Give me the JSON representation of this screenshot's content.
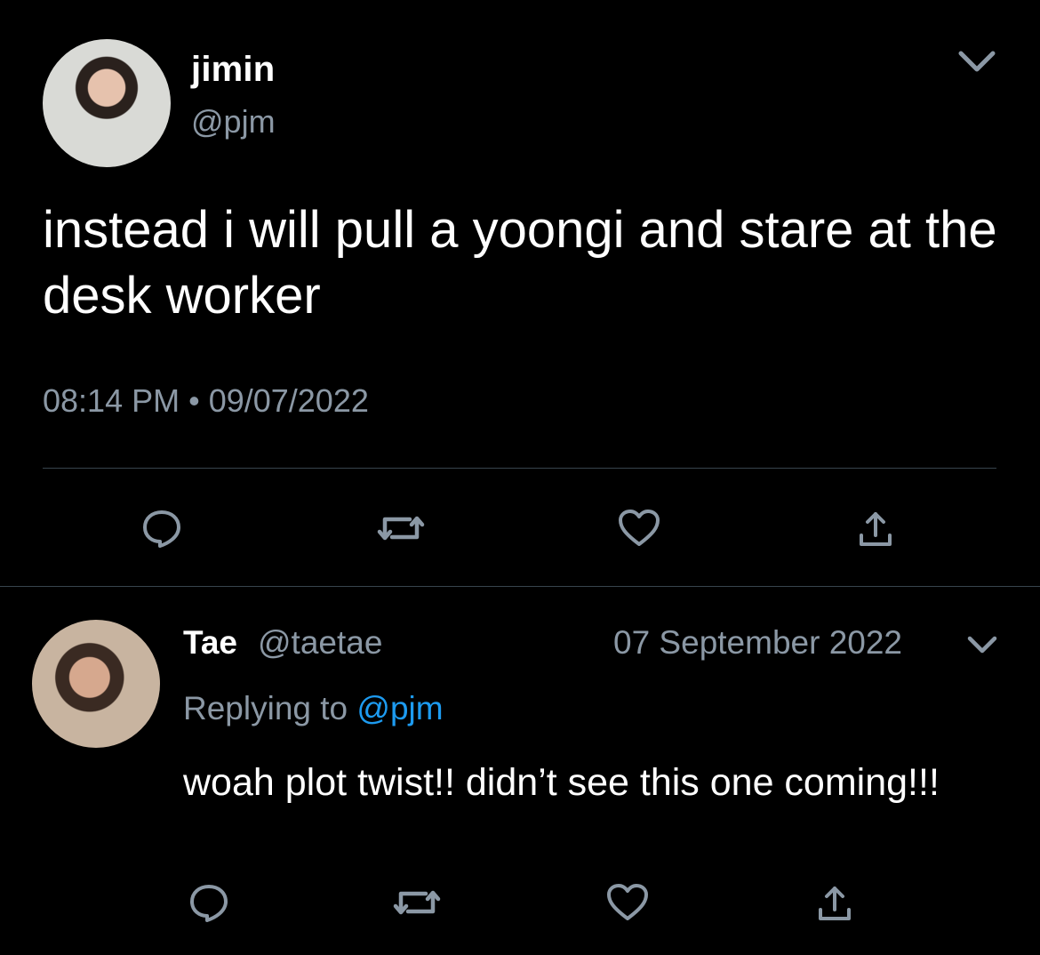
{
  "tweet": {
    "author_name": "jimin",
    "author_handle": "@pjm",
    "text": "instead i will pull a yoongi and stare at the desk worker",
    "timestamp": "08:14 PM • 09/07/2022",
    "actions": [
      "reply-icon",
      "retweet-icon",
      "like-icon",
      "share-icon"
    ]
  },
  "reply": {
    "author_name": "Tae",
    "author_handle": "@taetae",
    "date": "07 September 2022",
    "replying_prefix": "Replying to",
    "replying_to": "@pjm",
    "text": "woah plot twist!! didn’t see this one coming!!!",
    "actions": [
      "reply-icon",
      "retweet-icon",
      "like-icon",
      "share-icon"
    ]
  },
  "colors": {
    "background": "#000000",
    "text": "#ffffff",
    "secondary_text": "#8b98a5",
    "link": "#1d9bf0",
    "divider": "#38444d"
  }
}
